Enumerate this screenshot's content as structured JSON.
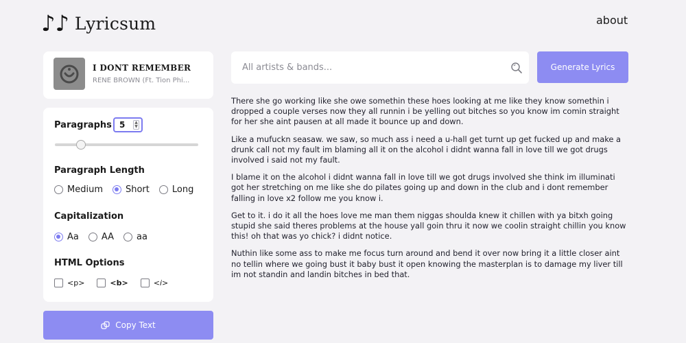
{
  "header": {
    "logo_notes": "♪♪",
    "logo_text": "Lyricsum",
    "about": "about"
  },
  "song": {
    "title": "I DONT REMEMBER",
    "artist": "RENE BROWN (Ft. Tion Phi..."
  },
  "settings": {
    "paragraphs_label": "Paragraphs",
    "paragraphs_value": "5",
    "slider_fraction": 0.18,
    "length_label": "Paragraph Length",
    "length_options": [
      "Medium",
      "Short",
      "Long"
    ],
    "length_selected": "Short",
    "cap_label": "Capitalization",
    "cap_options": [
      "Aa",
      "AA",
      "aa"
    ],
    "cap_selected": "Aa",
    "html_label": "HTML Options",
    "html_options": [
      "<p>",
      "<b>",
      "<i>"
    ]
  },
  "copy_button": "Copy Text",
  "search": {
    "placeholder": "All artists & bands..."
  },
  "generate_button": "Generate Lyrics",
  "accent_color": "#8d8cf2",
  "lyrics": [
    "There she go working like she owe somethin these hoes looking at me like they know somethin i dropped a couple verses now they all runnin i be yelling out bitches so you know im comin straight for her she aint pausen at all made it bounce up and down.",
    "Like a mufuckn seasaw. we saw, so much ass i need a u-hall get turnt up get fucked up and make a drunk call not my fault im blaming all it on the alcohol i didnt wanna fall in love till we got drugs involved i said not my fault.",
    "I blame it on the alcohol i didnt wanna fall in love till we got drugs involved she think im illuminati got her stretching on me like she do pilates going up and down in the club and i dont remember falling in love x2 follow me you know i.",
    "Get to it. i do it all the hoes love me man them niggas shoulda knew it chillen with ya bitxh going stupid she said theres problems at the house yall goin thru it now we coolin straight chillin you know this! oh that was yo chick? i didnt notice.",
    "Nuthin like some ass to make me focus turn around and bend it over now bring it a little closer aint no tellin where we going bust it baby bust it open knowing the masterplan is to damage my liver till im not standin and landin bitches in bed that."
  ]
}
